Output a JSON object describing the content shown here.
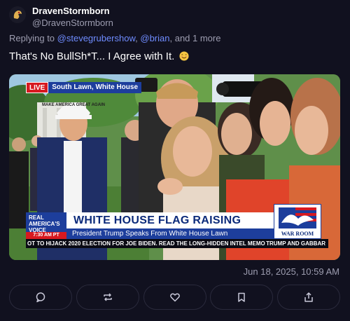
{
  "author": {
    "display_name": "DravenStormborn",
    "handle": "@DravenStormborn"
  },
  "reply": {
    "prefix": "Replying to ",
    "mention_1": "@stevegrubershow",
    "separator": ", ",
    "mention_2": "@brian",
    "suffix": ", and 1 more"
  },
  "post": {
    "text": "That's No BullSh*T... I Agree with It.",
    "emoji": "smiling-face-emoji"
  },
  "media": {
    "live_label": "LIVE",
    "location_label": "South Lawn, White House",
    "network_name": "REAL AMERICA'S VOICE",
    "network_time": "7:30 AM PT",
    "headline": "WHITE HOUSE FLAG RAISING",
    "subheadline": "President Trump Speaks From White House Lawn",
    "ticker_left": "OT TO HIJACK 2020 ELECTION FOR JOE BIDEN. READ THE LONG-HIDDEN INTEL MEMO",
    "ticker_right": "TRUMP AND GABBAR",
    "show_logo_text": "WAR ROOM",
    "hat_text": "MAKE AMERICA GREAT AGAIN"
  },
  "timestamp": "Jun 18, 2025, 10:59 AM",
  "actions": [
    {
      "name": "comment-button",
      "icon": "comment-icon"
    },
    {
      "name": "repost-button",
      "icon": "repost-icon"
    },
    {
      "name": "like-button",
      "icon": "heart-icon"
    },
    {
      "name": "bookmark-button",
      "icon": "bookmark-icon"
    },
    {
      "name": "share-button",
      "icon": "share-icon"
    }
  ],
  "colors": {
    "background": "#11111f",
    "accent": "#6f8cff",
    "muted": "#9d9db0"
  }
}
